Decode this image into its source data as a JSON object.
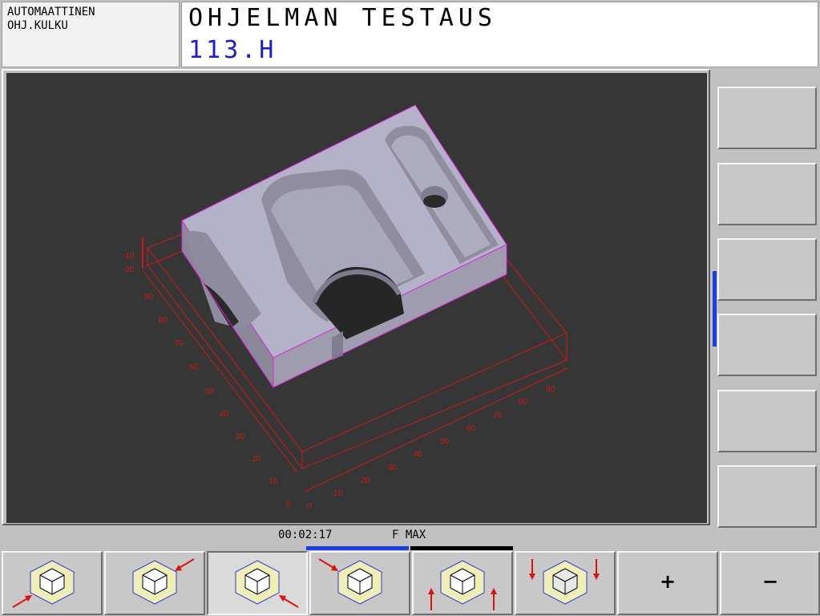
{
  "header": {
    "mode_line1": "AUTOMAATTINEN",
    "mode_line2": "OHJ.KULKU",
    "title": "OHJELMAN TESTAUS",
    "program": "113.H"
  },
  "graphic": {
    "z_labels": [
      "-10",
      "-20"
    ],
    "y_labels": [
      "0",
      "10",
      "20",
      "30",
      "40",
      "50",
      "60",
      "70",
      "80",
      "90"
    ],
    "x_labels": [
      "0",
      "10",
      "20",
      "30",
      "40",
      "50",
      "60",
      "70",
      "80",
      "90"
    ]
  },
  "status": {
    "time": "00:02:17",
    "feed": "F MAX"
  },
  "softkeys": {
    "view_front_left": "view-front-left-icon",
    "view_back_right": "view-back-right-icon",
    "view_front_right": "view-front-right-icon",
    "view_back_left": "view-back-left-icon",
    "view_bottom": "view-rotate-up-icon",
    "view_top": "view-rotate-down-icon",
    "plus_label": "+",
    "minus_label": "−"
  },
  "colors": {
    "accent_blue": "#1a3ee0",
    "program_blue": "#1a1ad6",
    "frame_red": "#cc1a1a",
    "outline_magenta": "#dd22dd",
    "workpiece": "#b4b2c8"
  }
}
